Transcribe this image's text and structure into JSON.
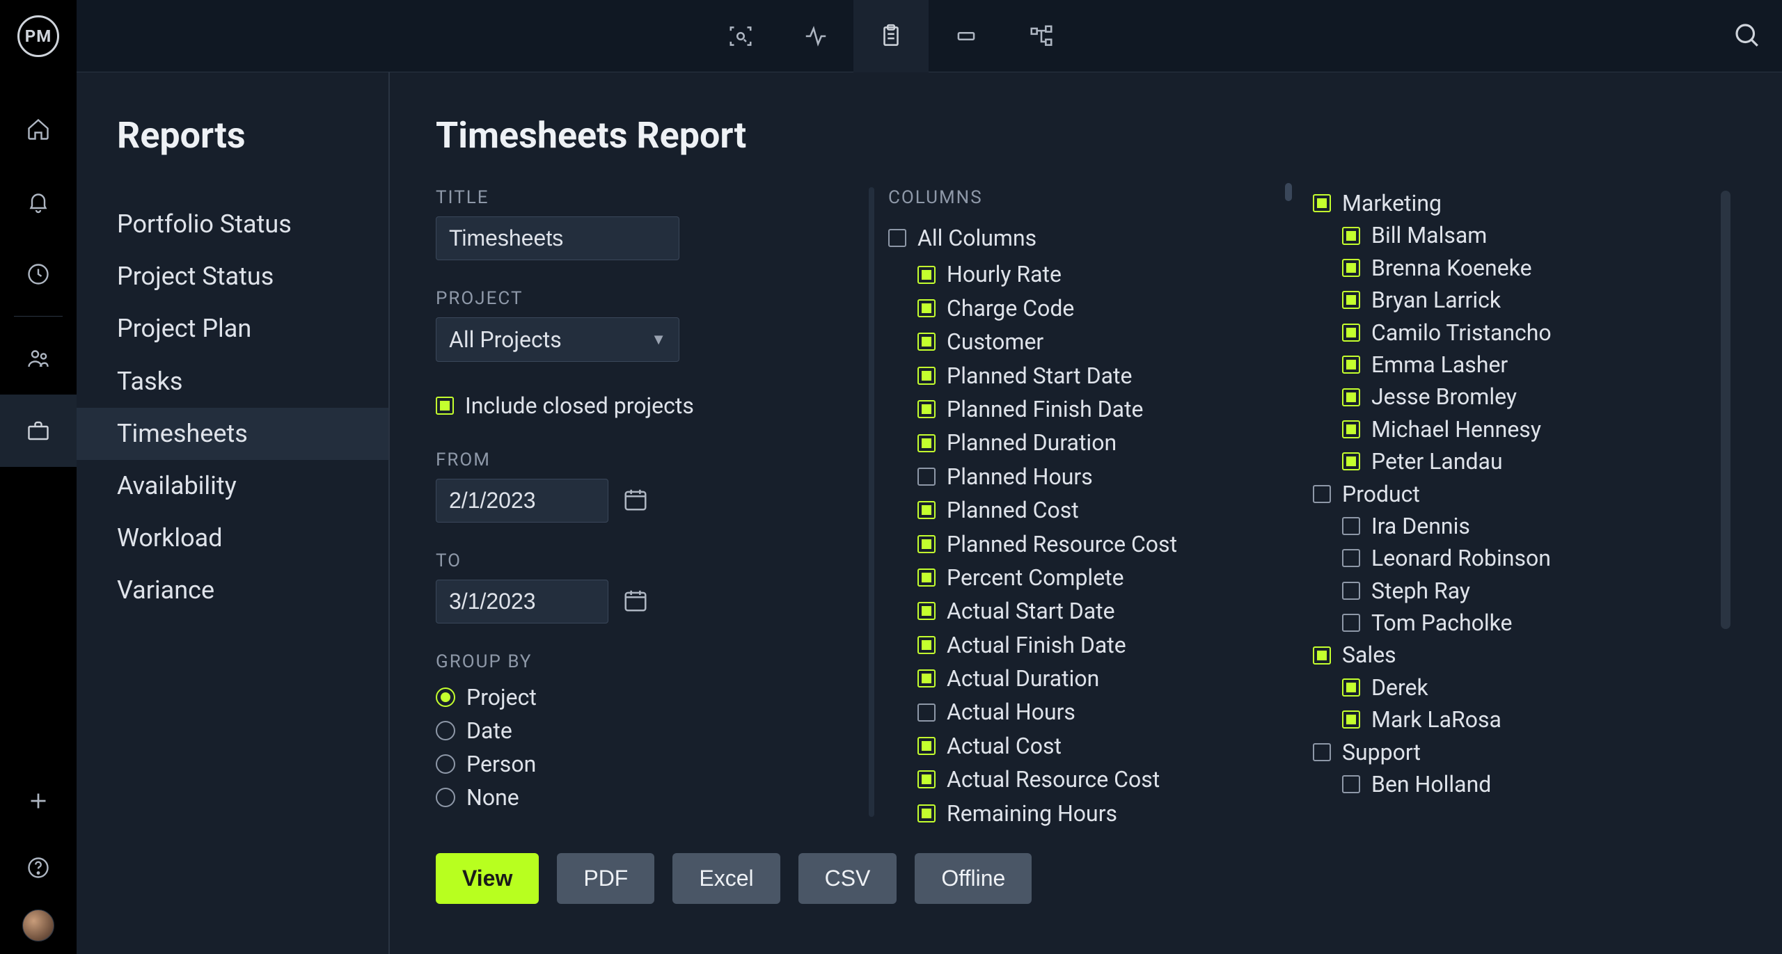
{
  "logo": "PM",
  "sidebar": {
    "title": "Reports",
    "items": [
      {
        "label": "Portfolio Status",
        "active": false
      },
      {
        "label": "Project Status",
        "active": false
      },
      {
        "label": "Project Plan",
        "active": false
      },
      {
        "label": "Tasks",
        "active": false
      },
      {
        "label": "Timesheets",
        "active": true
      },
      {
        "label": "Availability",
        "active": false
      },
      {
        "label": "Workload",
        "active": false
      },
      {
        "label": "Variance",
        "active": false
      }
    ]
  },
  "page": {
    "title": "Timesheets Report",
    "labels": {
      "title_field": "TITLE",
      "project_field": "PROJECT",
      "include_closed": "Include closed projects",
      "from_field": "FROM",
      "to_field": "TO",
      "group_by": "GROUP BY",
      "columns": "COLUMNS"
    },
    "fields": {
      "title_value": "Timesheets",
      "project_value": "All Projects",
      "include_closed_checked": true,
      "from_value": "2/1/2023",
      "to_value": "3/1/2023"
    },
    "group_by_options": [
      {
        "label": "Project",
        "checked": true
      },
      {
        "label": "Date",
        "checked": false
      },
      {
        "label": "Person",
        "checked": false
      },
      {
        "label": "None",
        "checked": false
      }
    ],
    "columns": {
      "all_label": "All Columns",
      "all_checked": false,
      "items": [
        {
          "label": "Hourly Rate",
          "checked": true
        },
        {
          "label": "Charge Code",
          "checked": true
        },
        {
          "label": "Customer",
          "checked": true
        },
        {
          "label": "Planned Start Date",
          "checked": true
        },
        {
          "label": "Planned Finish Date",
          "checked": true
        },
        {
          "label": "Planned Duration",
          "checked": true
        },
        {
          "label": "Planned Hours",
          "checked": false
        },
        {
          "label": "Planned Cost",
          "checked": true
        },
        {
          "label": "Planned Resource Cost",
          "checked": true
        },
        {
          "label": "Percent Complete",
          "checked": true
        },
        {
          "label": "Actual Start Date",
          "checked": true
        },
        {
          "label": "Actual Finish Date",
          "checked": true
        },
        {
          "label": "Actual Duration",
          "checked": true
        },
        {
          "label": "Actual Hours",
          "checked": false
        },
        {
          "label": "Actual Cost",
          "checked": true
        },
        {
          "label": "Actual Resource Cost",
          "checked": true
        },
        {
          "label": "Remaining Hours",
          "checked": true
        }
      ]
    },
    "teams": [
      {
        "name_label": "Marketing",
        "checked": true,
        "members": [
          {
            "label": "Bill Malsam",
            "checked": true
          },
          {
            "label": "Brenna Koeneke",
            "checked": true
          },
          {
            "label": "Bryan Larrick",
            "checked": true
          },
          {
            "label": "Camilo Tristancho",
            "checked": true
          },
          {
            "label": "Emma Lasher",
            "checked": true
          },
          {
            "label": "Jesse Bromley",
            "checked": true
          },
          {
            "label": "Michael Hennesy",
            "checked": true
          },
          {
            "label": "Peter Landau",
            "checked": true
          }
        ]
      },
      {
        "name_label": "Product",
        "checked": false,
        "members": [
          {
            "label": "Ira Dennis",
            "checked": false
          },
          {
            "label": "Leonard Robinson",
            "checked": false
          },
          {
            "label": "Steph Ray",
            "checked": false
          },
          {
            "label": "Tom Pacholke",
            "checked": false
          }
        ]
      },
      {
        "name_label": "Sales",
        "checked": true,
        "members": [
          {
            "label": "Derek",
            "checked": true
          },
          {
            "label": "Mark LaRosa",
            "checked": true
          }
        ]
      },
      {
        "name_label": "Support",
        "checked": false,
        "members": [
          {
            "label": "Ben Holland",
            "checked": false
          }
        ]
      }
    ],
    "buttons": {
      "view": "View",
      "pdf": "PDF",
      "excel": "Excel",
      "csv": "CSV",
      "offline": "Offline"
    }
  }
}
